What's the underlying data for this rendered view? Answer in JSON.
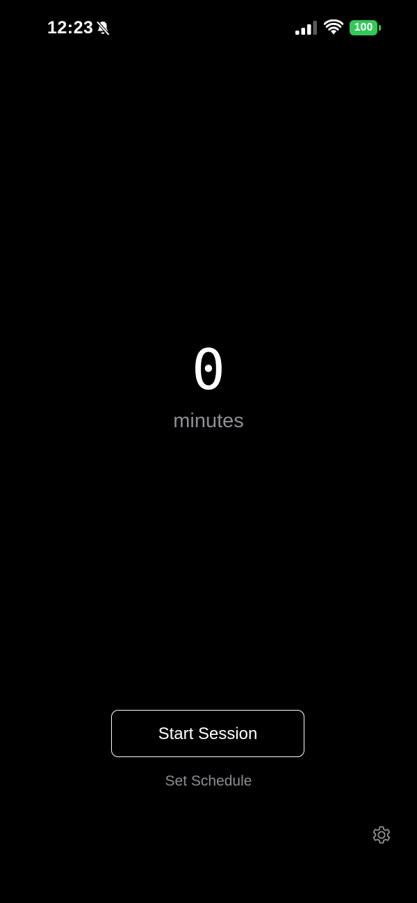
{
  "status_bar": {
    "time": "12:23",
    "silent_icon": "bell-slash-icon",
    "signal_icon": "cellular-signal-icon",
    "wifi_icon": "wifi-icon",
    "battery_level": "100",
    "battery_color": "#34c759"
  },
  "counter": {
    "value": "0",
    "unit": "minutes"
  },
  "actions": {
    "start_label": "Start Session",
    "schedule_label": "Set Schedule"
  },
  "settings": {
    "icon": "gear-icon"
  },
  "colors": {
    "background": "#000000",
    "text": "#ffffff",
    "muted": "#8e8e93"
  }
}
